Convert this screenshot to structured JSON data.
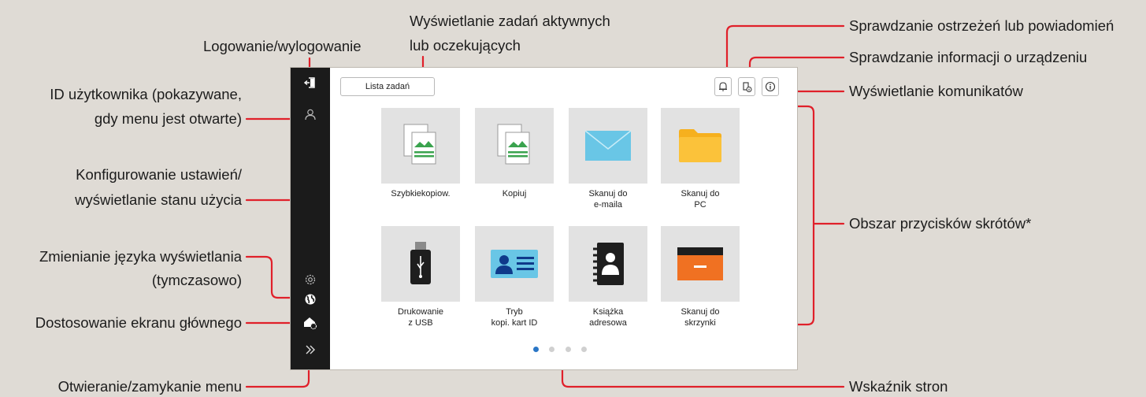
{
  "callouts": {
    "login": "Logowanie/wylogowanie",
    "jobs_line1": "Wyświetlanie zadań aktywnych",
    "jobs_line2": "lub oczekujących",
    "userid_line1": "ID użytkownika (pokazywane,",
    "userid_line2": "gdy menu jest otwarte)",
    "settings_line1": "Konfigurowanie ustawień/",
    "settings_line2": "wyświetlanie stanu użycia",
    "language_line1": "Zmienianie języka wyświetlania",
    "language_line2": "(tymczasowo)",
    "customize": "Dostosowanie ekranu głównego",
    "menu": "Otwieranie/zamykanie menu",
    "alerts": "Sprawdzanie ostrzeżeń lub powiadomień",
    "device_info": "Sprawdzanie informacji o urządzeniu",
    "messages": "Wyświetlanie komunikatów",
    "shortcuts": "Obszar przycisków skrótów*",
    "pages": "Wskaźnik stron"
  },
  "screen": {
    "job_list_label": "Lista zadań",
    "tiles": [
      {
        "label": "Szybkiekopiow.",
        "icon": "copy-document-icon"
      },
      {
        "label": "Kopiuj",
        "icon": "copy-document-icon"
      },
      {
        "label": "Skanuj do\ne-maila",
        "icon": "envelope-icon"
      },
      {
        "label": "Skanuj do\nPC",
        "icon": "folder-icon"
      },
      {
        "label": "Drukowanie\nz USB",
        "icon": "usb-drive-icon"
      },
      {
        "label": "Tryb\nkopi. kart ID",
        "icon": "id-card-icon"
      },
      {
        "label": "Książka\nadresowa",
        "icon": "address-book-icon"
      },
      {
        "label": "Skanuj do\nskrzynki",
        "icon": "box-tray-icon"
      }
    ],
    "page_count": 4,
    "active_page": 1
  },
  "colors": {
    "callout_line": "#e0202a",
    "sidebar": "#1b1b1b",
    "background": "#dfdbd5",
    "active_dot": "#2a76c6"
  }
}
